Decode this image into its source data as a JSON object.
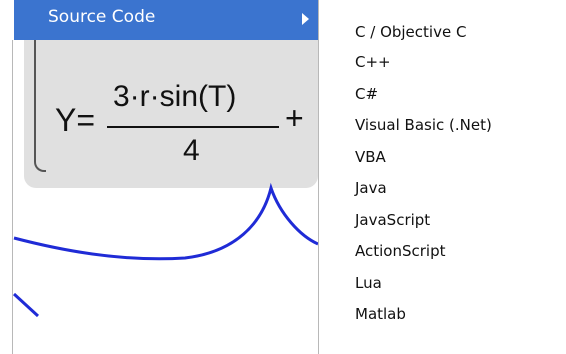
{
  "parent_menu": {
    "highlighted_item": "Source Code",
    "highlight_color": "#3b74cf",
    "arrow_icon": "submenu-arrow-icon"
  },
  "formula": {
    "lhs": "Y=",
    "numerator": "3·r·sin(T)",
    "denominator": "4",
    "trailing": "+"
  },
  "plot": {
    "curve_color": "#1f2bd6",
    "panel_color": "#e0e0e0"
  },
  "submenu": {
    "items": [
      "C / Objective C",
      "C++",
      "C#",
      "Visual Basic (.Net)",
      "VBA",
      "Java",
      "JavaScript",
      "ActionScript",
      "Lua",
      "Matlab"
    ]
  }
}
